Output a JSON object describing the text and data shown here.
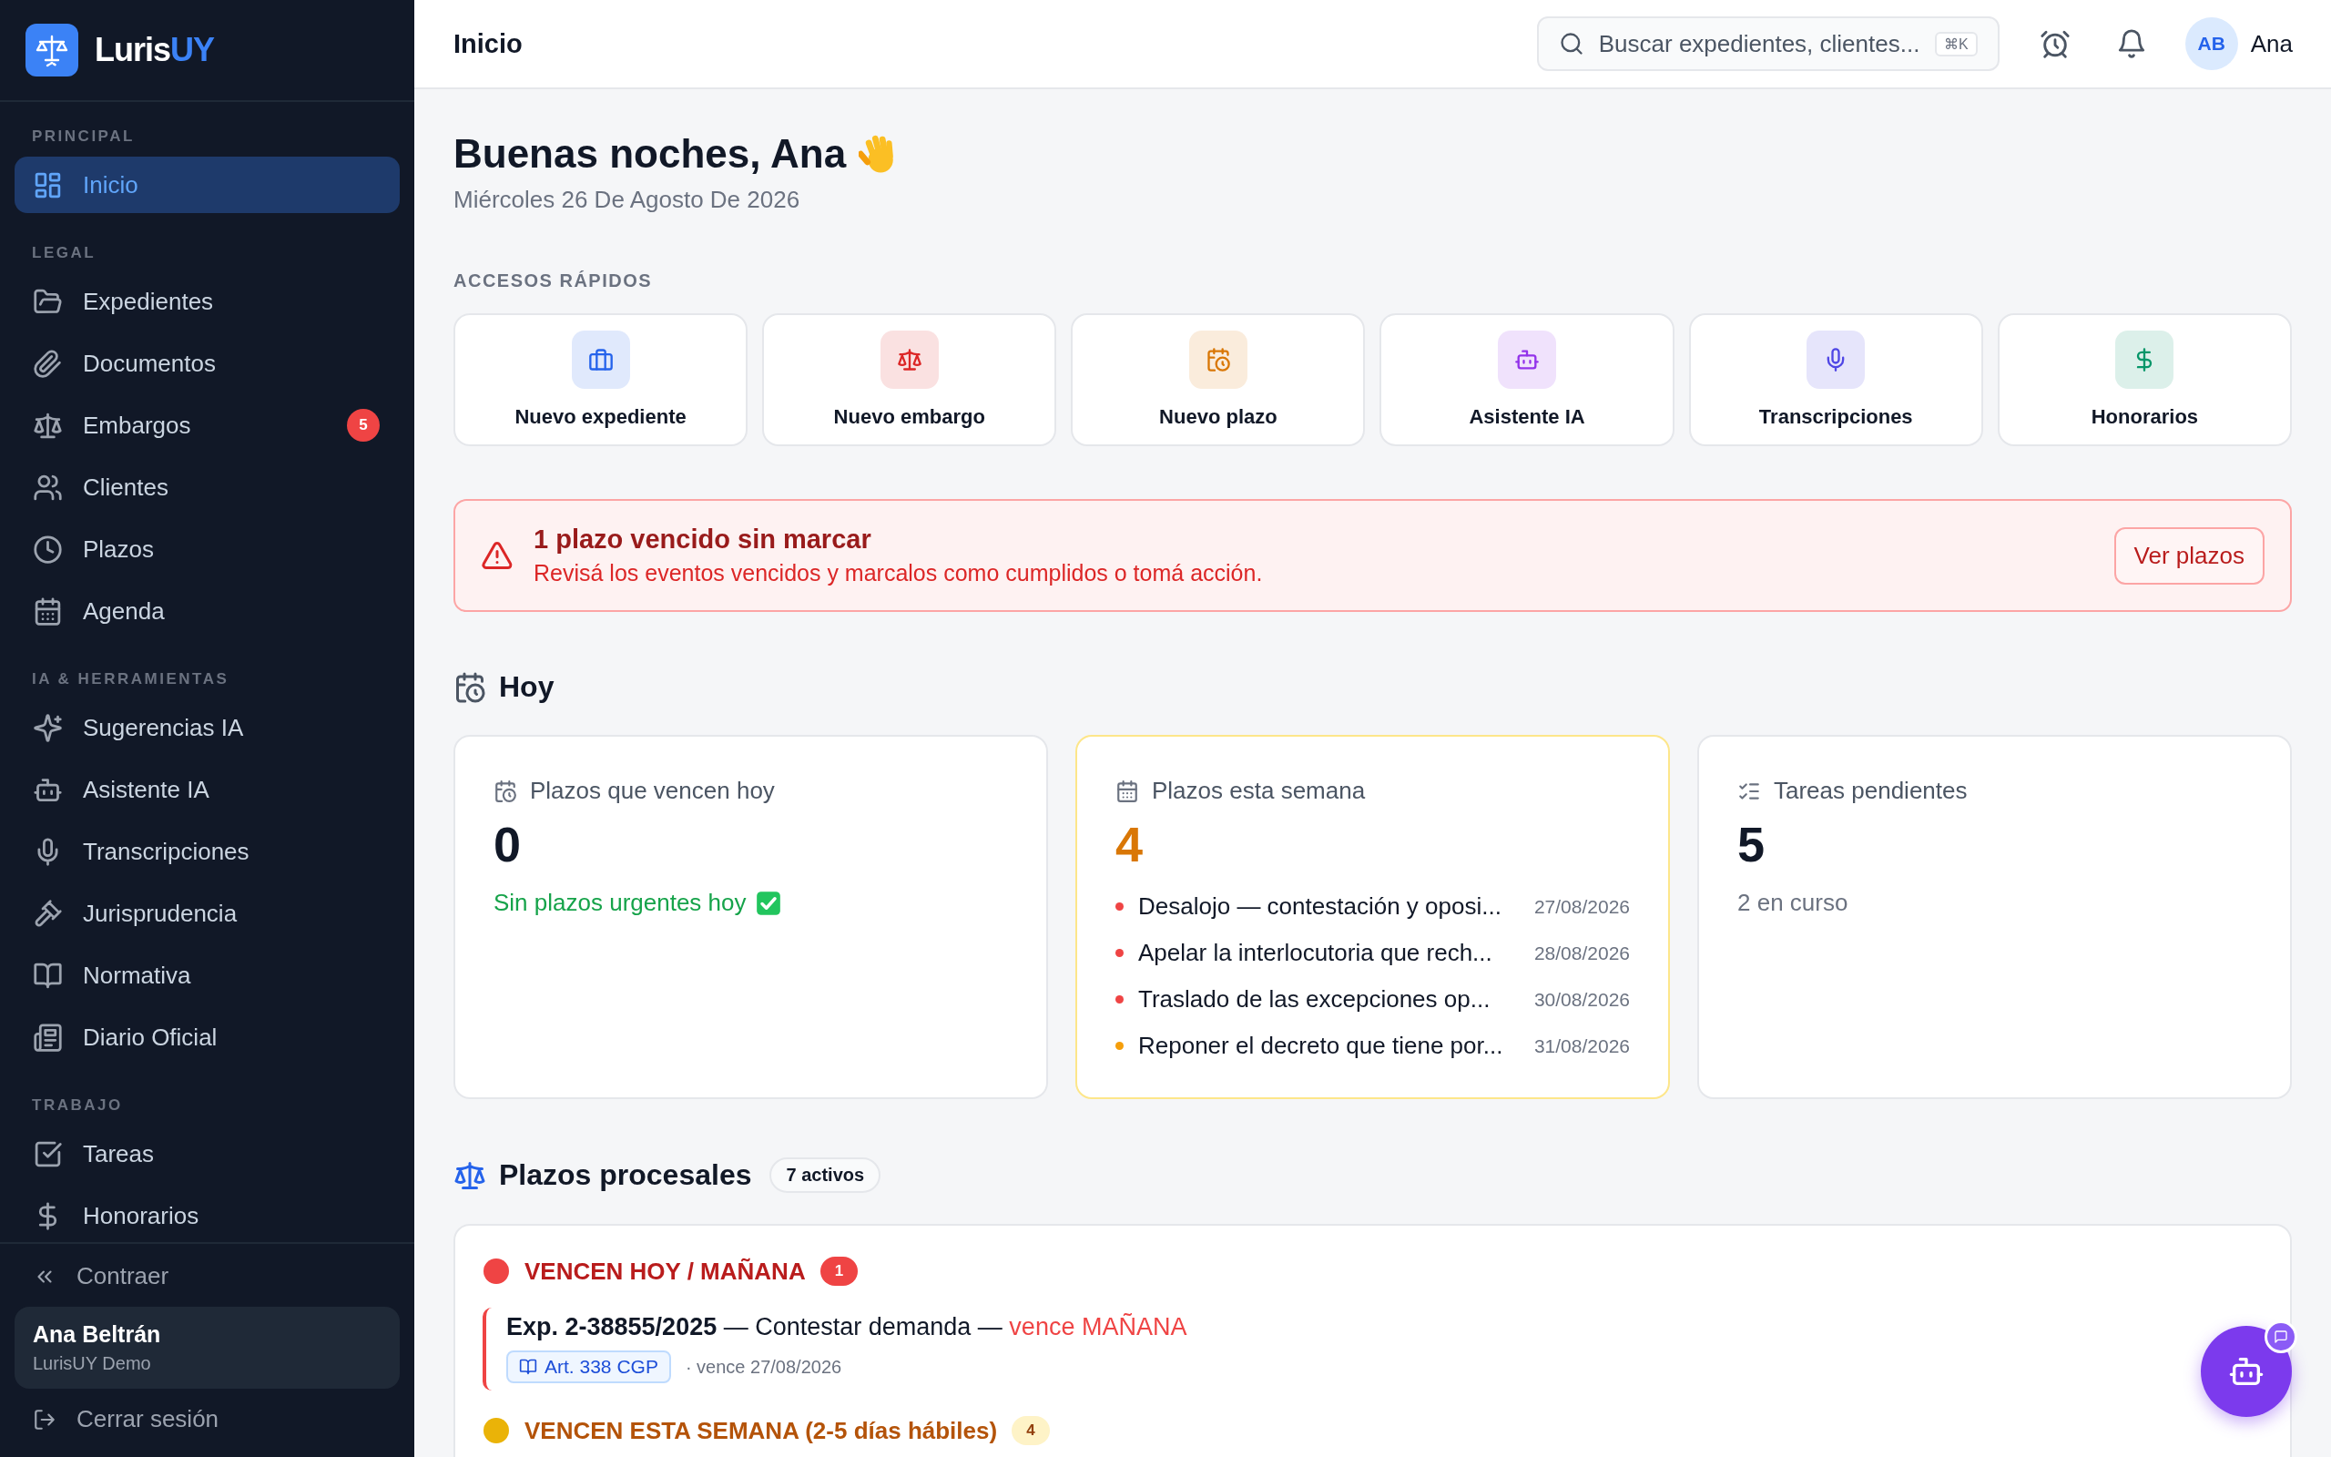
{
  "brand": {
    "name": "Luris",
    "accent": "UY"
  },
  "sidebar": {
    "sections": [
      {
        "label": "PRINCIPAL",
        "items": [
          {
            "label": "Inicio",
            "selected": true
          }
        ]
      },
      {
        "label": "LEGAL",
        "items": [
          {
            "label": "Expedientes",
            "selected": false
          },
          {
            "label": "Documentos",
            "selected": false
          },
          {
            "label": "Embargos",
            "selected": false,
            "badge": "5"
          },
          {
            "label": "Clientes",
            "selected": false
          },
          {
            "label": "Plazos",
            "selected": false
          },
          {
            "label": "Agenda",
            "selected": false
          }
        ]
      },
      {
        "label": "IA & HERRAMIENTAS",
        "items": [
          {
            "label": "Sugerencias IA",
            "selected": false
          },
          {
            "label": "Asistente IA",
            "selected": false
          },
          {
            "label": "Transcripciones",
            "selected": false
          },
          {
            "label": "Jurisprudencia",
            "selected": false
          },
          {
            "label": "Normativa",
            "selected": false
          },
          {
            "label": "Diario Oficial",
            "selected": false
          }
        ]
      },
      {
        "label": "TRABAJO",
        "items": [
          {
            "label": "Tareas",
            "selected": false
          },
          {
            "label": "Honorarios",
            "selected": false
          }
        ]
      }
    ],
    "collapse": "Contraer",
    "user": {
      "name": "Ana Beltrán",
      "org": "LurisUY Demo"
    },
    "logout": "Cerrar sesión"
  },
  "header": {
    "title": "Inicio",
    "search": {
      "placeholder": "Buscar expedientes, clientes...",
      "shortcut": "⌘K"
    },
    "user": {
      "initials": "AB",
      "name": "Ana"
    }
  },
  "greeting": {
    "title": "Buenas noches, Ana",
    "date": "Miércoles 26 De Agosto De 2026"
  },
  "quick_access": {
    "label": "ACCESOS RÁPIDOS",
    "items": [
      {
        "label": "Nuevo expediente",
        "color": "#2563eb"
      },
      {
        "label": "Nuevo embargo",
        "color": "#dc2626"
      },
      {
        "label": "Nuevo plazo",
        "color": "#d97706"
      },
      {
        "label": "Asistente IA",
        "color": "#9333ea"
      },
      {
        "label": "Transcripciones",
        "color": "#4f46e5"
      },
      {
        "label": "Honorarios",
        "color": "#059669"
      }
    ]
  },
  "alert": {
    "title": "1 plazo vencido sin marcar",
    "message": "Revisá los eventos vencidos y marcalos como cumplidos o tomá acción.",
    "action": "Ver plazos"
  },
  "today": {
    "title": "Hoy",
    "cards": [
      {
        "label": "Plazos que vencen hoy",
        "value": "0",
        "highlighted": false,
        "note": "Sin plazos urgentes hoy",
        "kind": "success"
      },
      {
        "label": "Plazos esta semana",
        "value": "4",
        "highlighted": true,
        "items": [
          {
            "text": "Desalojo — contestación y oposi...",
            "date": "27/08/2026",
            "color": "#ef4444"
          },
          {
            "text": "Apelar la interlocutoria que rech...",
            "date": "28/08/2026",
            "color": "#ef4444"
          },
          {
            "text": "Traslado de las excepciones op...",
            "date": "30/08/2026",
            "color": "#ef4444"
          },
          {
            "text": "Reponer el decreto que tiene por...",
            "date": "31/08/2026",
            "color": "#f59e0b"
          }
        ]
      },
      {
        "label": "Tareas pendientes",
        "value": "5",
        "highlighted": false,
        "note": "2 en curso",
        "kind": "muted"
      }
    ]
  },
  "deadlines": {
    "title": "Plazos procesales",
    "count": "7 activos",
    "groups": [
      {
        "title": "VENCEN HOY / MAÑANA",
        "count": "1",
        "color": "#ef4444",
        "kind": "danger",
        "items": [
          {
            "title": "**Exp. 2-38855/2025** — Contestar demanda —",
            "due": "vence MAÑANA",
            "article": "Art. 338 CGP",
            "date": "· vence 27/08/2026"
          }
        ]
      },
      {
        "title": "VENCEN ESTA SEMANA (2-5 días hábiles)",
        "count": "4",
        "color": "#eab308",
        "kind": "warning"
      }
    ]
  }
}
